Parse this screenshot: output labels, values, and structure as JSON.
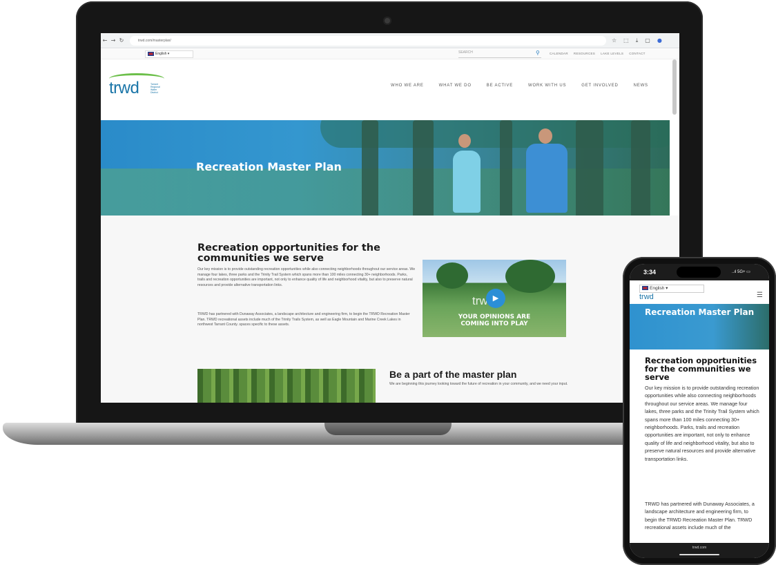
{
  "browser": {
    "nav_buttons": [
      "←",
      "→",
      "↻"
    ],
    "url": "trwd.com/masterplan/",
    "icons": [
      "☆",
      "⬚",
      "⤓",
      "▢",
      "●"
    ]
  },
  "utility_bar": {
    "language": "English",
    "search_placeholder": "SEARCH",
    "links": [
      "CALENDAR",
      "RESOURCES",
      "LAKE LEVELS",
      "CONTACT"
    ]
  },
  "header": {
    "logo_text": "trwd",
    "logo_subtitle": "Tarrant Regional Water District",
    "nav": [
      "WHO WE ARE",
      "WHAT WE DO",
      "BE ACTIVE",
      "WORK WITH US",
      "GET INVOLVED",
      "NEWS"
    ]
  },
  "hero": {
    "title": "Recreation Master Plan"
  },
  "content": {
    "heading": "Recreation opportunities for the communities we serve",
    "paragraph1": "Our key mission is to provide outstanding recreation opportunities while also connecting neighborhoods throughout our service areas. We manage four lakes, three parks and the Trinity Trail System which spans more than 100 miles connecting 30+ neighborhoods. Parks, trails and recreation opportunities are important, not only to enhance quality of life and neighborhood vitality, but also to preserve natural resources and provide alternative transportation links.",
    "paragraph2": "TRWD has partnered with Dunaway Associates, a landscape architecture and engineering firm, to begin the TRWD Recreation Master Plan. TRWD recreational assets include much of the Trinity Trails System, as well as Eagle Mountain and Marine Creek Lakes in northwest Tarrant County. spaces specific to these assets.",
    "video": {
      "logo": "trwd",
      "caption_line1": "YOUR OPINIONS ARE",
      "caption_line2": "COMING INTO PLAY"
    },
    "part_heading": "Be a part of the master plan",
    "part_text": "We are beginning this journey looking toward the future of recreation in your community, and we need your input."
  },
  "phone": {
    "time": "3:34",
    "signal": "..ıl 5G+ ▭",
    "language": "English",
    "logo_text": "trwd",
    "hero_title": "Recreation Master Plan",
    "heading": "Recreation opportunities for the communities we serve",
    "paragraph1": "Our key mission is to provide outstanding recreation opportunities while also connecting neighborhoods throughout our service areas. We manage four lakes, three parks and the Trinity Trail System which spans more than 100 miles connecting 30+ neighborhoods. Parks, trails and recreation opportunities are important, not only to enhance quality of life and neighborhood vitality, but also to preserve natural resources and provide alternative transportation links.",
    "paragraph2": "TRWD has partnered with Dunaway Associates, a landscape architecture and engineering firm, to begin the TRWD Recreation Master Plan. TRWD recreational assets include much of the",
    "url": "trwd.com"
  },
  "colors": {
    "brand_blue": "#1a75a8",
    "brand_green": "#6cbf4a",
    "hero_blue": "#2a8bc9",
    "play_button": "#2b8fd6"
  }
}
